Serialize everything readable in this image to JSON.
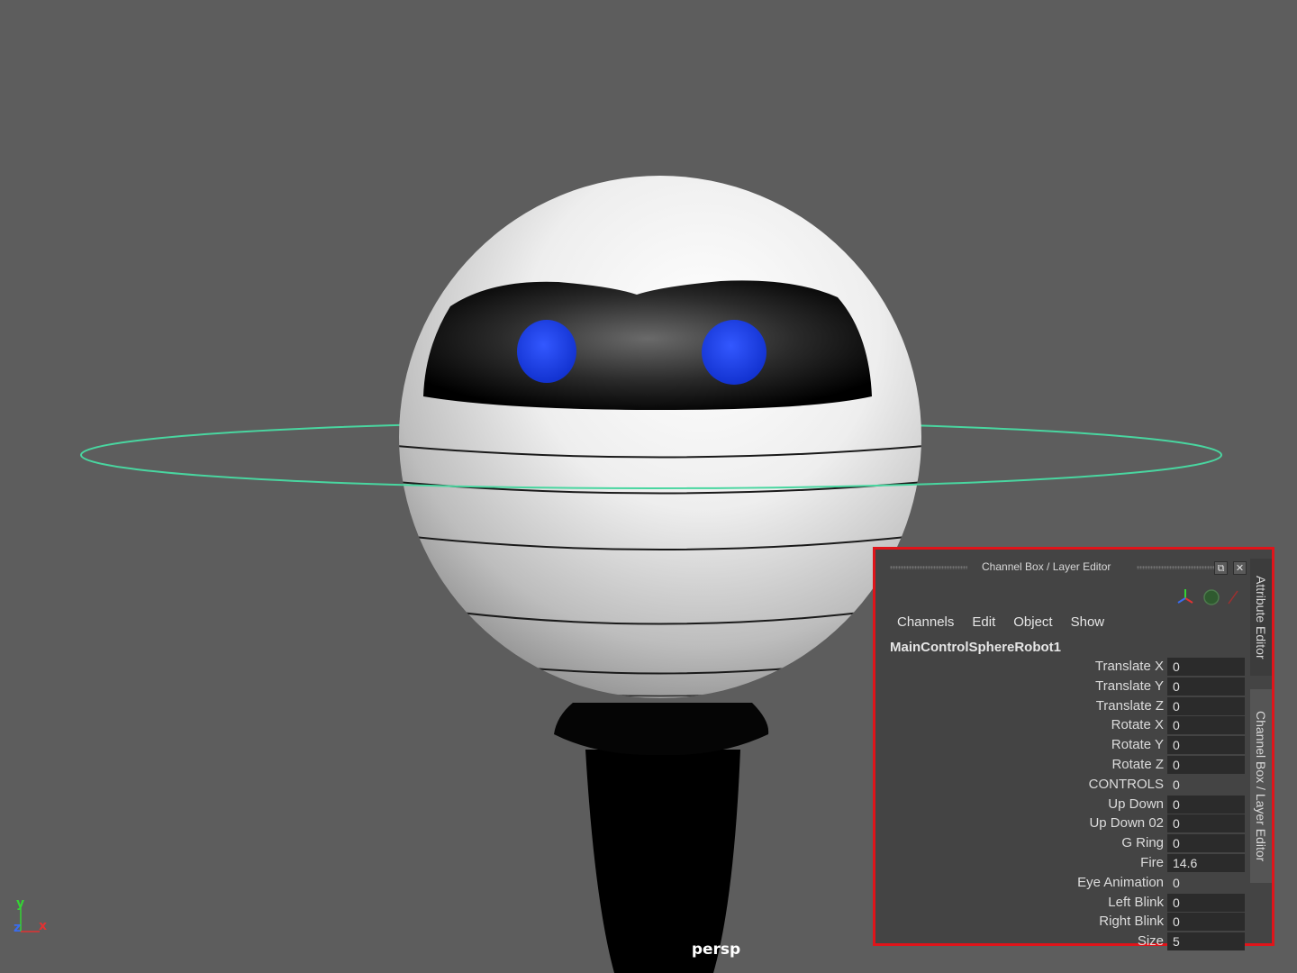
{
  "viewport": {
    "camera_label": "persp",
    "axis": {
      "y": "y",
      "z": "z",
      "x": "x"
    },
    "colors": {
      "background": "#5d5d5d",
      "eyes": "#1f3fe8",
      "control_ring": "#49d6a0",
      "axis_y": "#35d335",
      "axis_x": "#e23232",
      "axis_z": "#3a6cf0"
    }
  },
  "panel": {
    "title": "Channel Box / Layer Editor",
    "float_icon": "float-window-icon",
    "close_icon": "close-icon",
    "highlight_color": "#e0141a",
    "menu": [
      "Channels",
      "Edit",
      "Object",
      "Show"
    ],
    "object_name": "MainControlSphereRobot1",
    "channels": [
      {
        "label": "Translate X",
        "value": "0",
        "field": true
      },
      {
        "label": "Translate Y",
        "value": "0",
        "field": true
      },
      {
        "label": "Translate Z",
        "value": "0",
        "field": true
      },
      {
        "label": "Rotate X",
        "value": "0",
        "field": true
      },
      {
        "label": "Rotate Y",
        "value": "0",
        "field": true
      },
      {
        "label": "Rotate Z",
        "value": "0",
        "field": true
      },
      {
        "label": "CONTROLS",
        "value": "0",
        "field": false
      },
      {
        "label": "Up Down",
        "value": "0",
        "field": true
      },
      {
        "label": "Up Down 02",
        "value": "0",
        "field": true
      },
      {
        "label": "G Ring",
        "value": "0",
        "field": true
      },
      {
        "label": "Fire",
        "value": "14.6",
        "field": true
      },
      {
        "label": "Eye Animation",
        "value": "0",
        "field": false
      },
      {
        "label": "Left Blink",
        "value": "0",
        "field": true
      },
      {
        "label": "Right Blink",
        "value": "0",
        "field": true
      },
      {
        "label": "Size",
        "value": "5",
        "field": true
      }
    ],
    "side_tabs": {
      "attribute_editor": "Attribute Editor",
      "channel_box": "Channel Box / Layer Editor"
    }
  }
}
